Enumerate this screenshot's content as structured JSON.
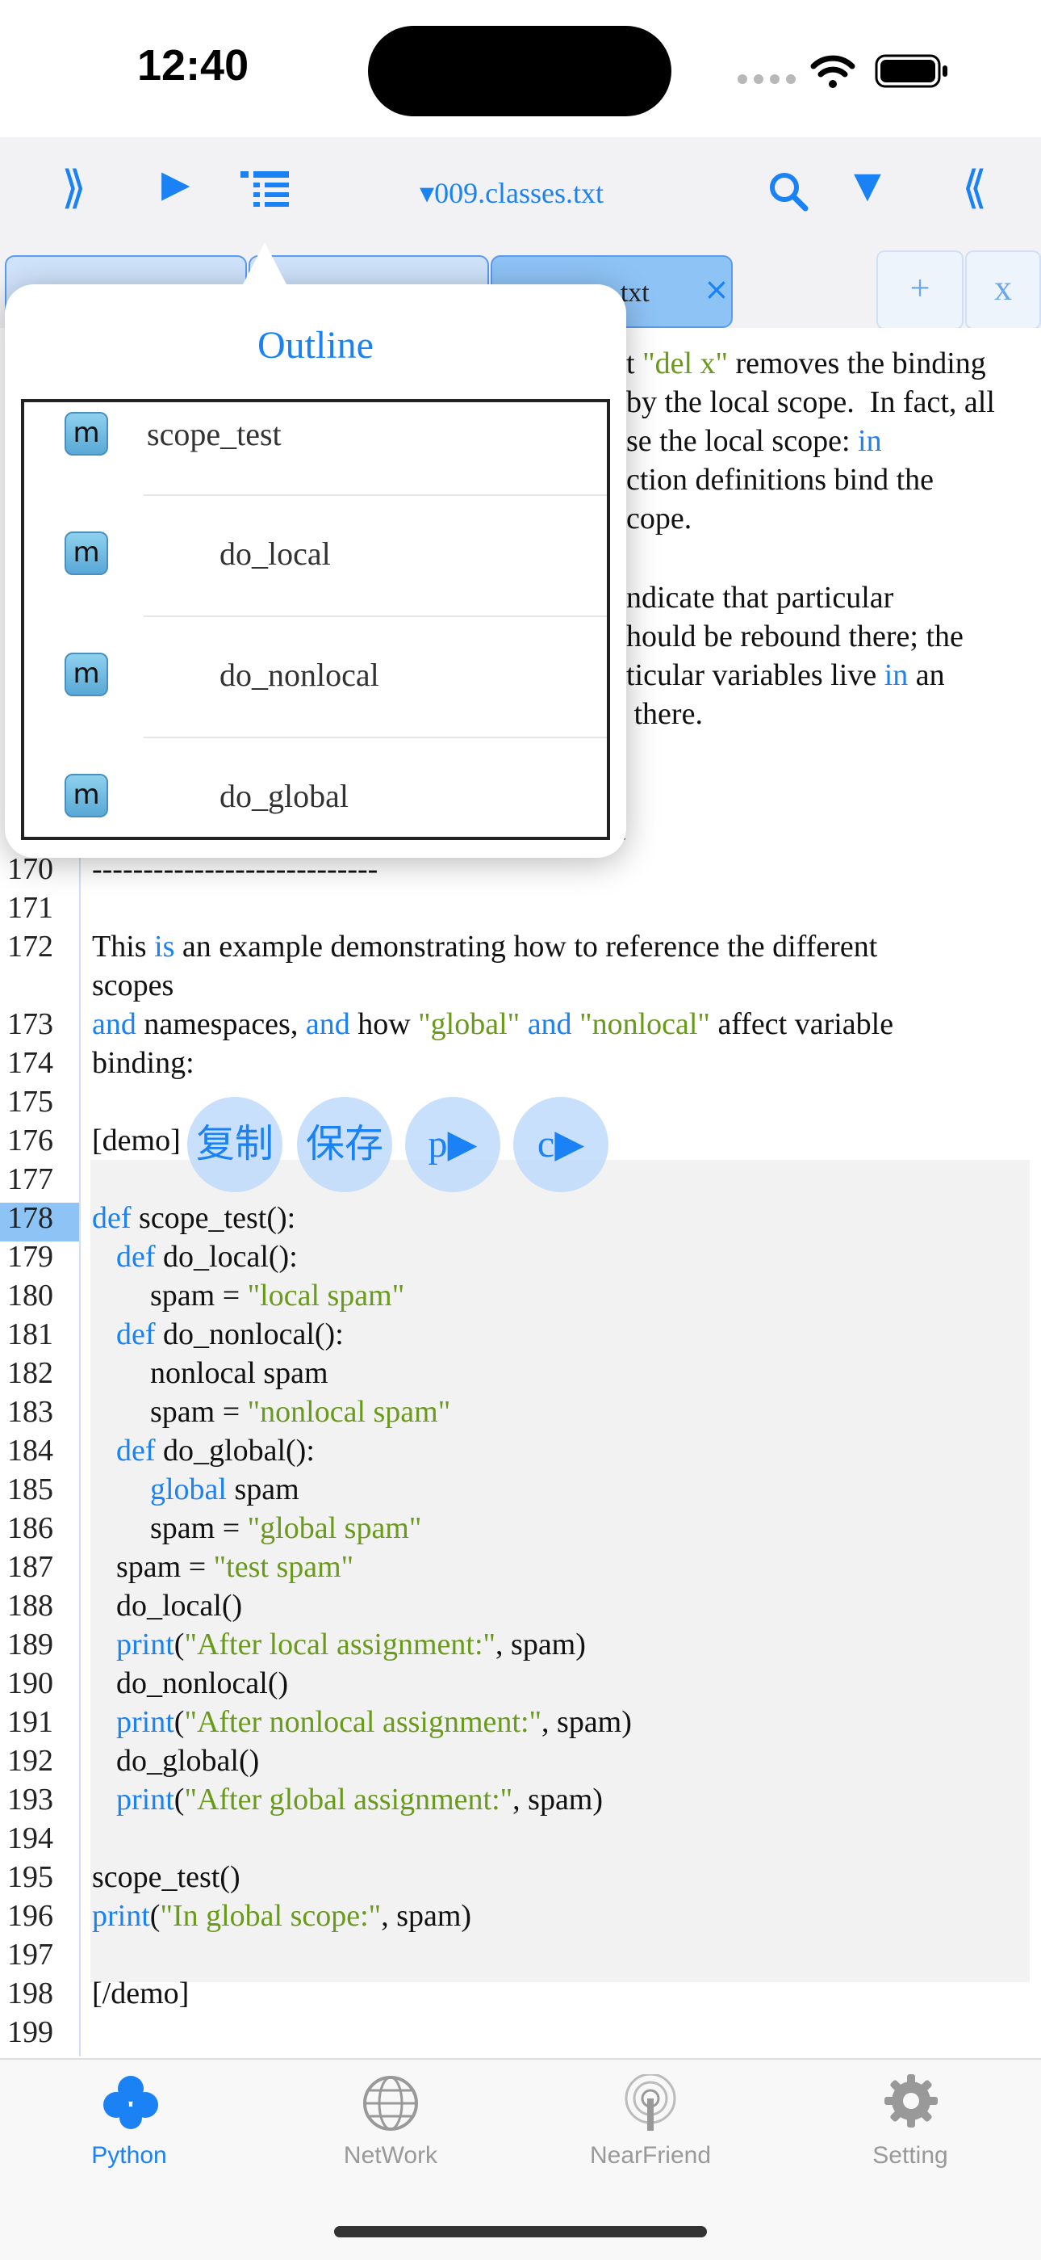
{
  "status_bar": {
    "time": "12:40"
  },
  "toolbar": {
    "expand_icon": "⟫",
    "run_icon": "▶",
    "list_icon": "outline-list",
    "file_title": "▾009.classes.txt",
    "search_icon": "search",
    "dropdown_icon": "▼",
    "collapse_icon": "⟪"
  },
  "tabs": {
    "active_tab_label": "es.txt",
    "close": "×",
    "add": "+",
    "close_all": "x"
  },
  "outline": {
    "title": "Outline",
    "items": [
      {
        "icon": "m",
        "label": "scope_test"
      },
      {
        "icon": "m",
        "label": "do_local"
      },
      {
        "icon": "m",
        "label": "do_nonlocal"
      },
      {
        "icon": "m",
        "label": "do_global"
      }
    ]
  },
  "editor": {
    "visible_text": {
      "l1_a": "t ",
      "l1_b": "\"del x\"",
      "l1_c": " removes the binding",
      "l2": "by the local scope.  In fact, all",
      "l3_a": "se the local scope: ",
      "l3_b": "in",
      "l4": "ction definitions bind the",
      "l5": "cope.",
      "l6": "ndicate that particular",
      "l7": "hould be rebound there; the",
      "l8_a": "ticular variables live ",
      "l8_b": "in",
      "l8_c": " an",
      "l9": " there.",
      "l10": "e"
    },
    "line_numbers": [
      "170",
      "171",
      "172",
      "",
      "173",
      "174",
      "175",
      "176",
      "177",
      "178",
      "179",
      "180",
      "181",
      "182",
      "183",
      "184",
      "185",
      "186",
      "187",
      "188",
      "189",
      "190",
      "191",
      "192",
      "193",
      "194",
      "195",
      "196",
      "197",
      "198",
      "199"
    ],
    "lines": {
      "170": "----------------------------",
      "172_a": "This ",
      "172_b": "is",
      "172_c": " an example demonstrating how to reference the different",
      "172w": "scopes",
      "173_a": "and",
      "173_b": " namespaces, ",
      "173_c": "and",
      "173_d": " how ",
      "173_e": "\"global\"",
      "173_f": " ",
      "173_g": "and",
      "173_h": " ",
      "173_i": "\"nonlocal\"",
      "173_j": " affect variable",
      "174": "binding:",
      "176": "[demo]",
      "178_a": "def",
      "178_b": " scope_test():",
      "179_a": "def",
      "179_b": " do_local():",
      "180_a": "spam = ",
      "180_b": "\"local spam\"",
      "181_a": "def",
      "181_b": " do_nonlocal():",
      "182": "nonlocal spam",
      "183_a": "spam = ",
      "183_b": "\"nonlocal spam\"",
      "184_a": "def",
      "184_b": " do_global():",
      "185_a": "global",
      "185_b": " spam",
      "186_a": "spam = ",
      "186_b": "\"global spam\"",
      "187_a": "spam = ",
      "187_b": "\"test spam\"",
      "188": "do_local()",
      "189_a": "print",
      "189_b": "(",
      "189_c": "\"After local assignment:\"",
      "189_d": ", spam)",
      "190": "do_nonlocal()",
      "191_a": "print",
      "191_b": "(",
      "191_c": "\"After nonlocal assignment:\"",
      "191_d": ", spam)",
      "192": "do_global()",
      "193_a": "print",
      "193_b": "(",
      "193_c": "\"After global assignment:\"",
      "193_d": ", spam)",
      "195": "scope_test()",
      "196_a": "print",
      "196_b": "(",
      "196_c": "\"In global scope:\"",
      "196_d": ", spam)",
      "198": "[/demo]"
    }
  },
  "floating_buttons": {
    "copy": "复制",
    "save": "保存",
    "p": "p▶",
    "c": "c▶"
  },
  "tabbar": {
    "items": [
      {
        "label": "Python",
        "icon": "python-icon",
        "active": true
      },
      {
        "label": "NetWork",
        "icon": "globe-icon"
      },
      {
        "label": "NearFriend",
        "icon": "antenna-icon"
      },
      {
        "label": "Setting",
        "icon": "gear-icon"
      }
    ]
  },
  "colors": {
    "accent": "#1a82f5",
    "string": "#6a9a1a",
    "inactive": "#999999"
  }
}
